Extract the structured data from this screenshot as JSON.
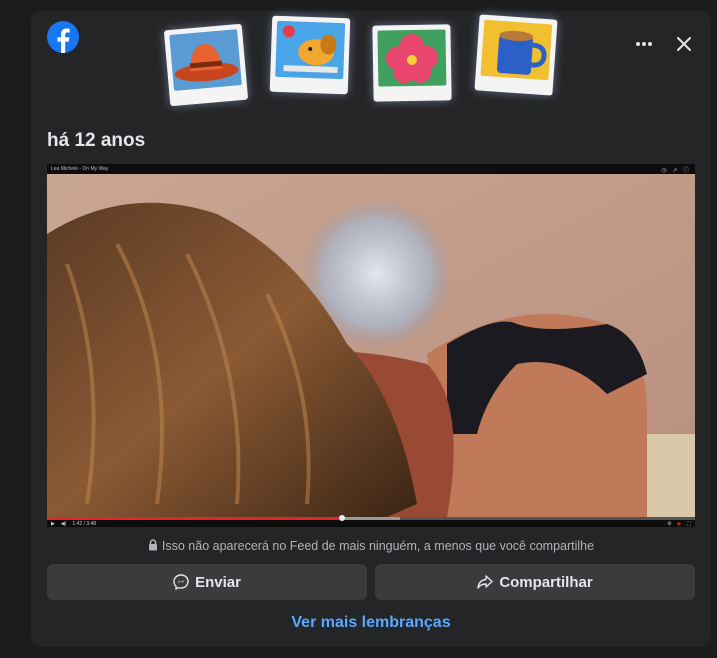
{
  "memory": {
    "date_label": "há 12 anos",
    "privacy_notice": "Isso não aparecerá no Feed de mais ninguém, a menos que você compartilhe",
    "send_label": "Enviar",
    "share_label": "Compartilhar",
    "more_memories_label": "Ver mais lembranças"
  },
  "video": {
    "title": "Lea Michele - On My Way",
    "progress": 0.455,
    "buffered": 0.545,
    "time_text": "1:42 / 3:48"
  },
  "header": {
    "polaroids": [
      "cowboy-hat-sticker",
      "dog-sticker",
      "hibiscus-flower-sticker",
      "coffee-mug-sticker"
    ]
  },
  "colors": {
    "card_bg": "#242526",
    "button_bg": "#3a3b3c",
    "link_blue": "#5aa7ff",
    "facebook_blue": "#1877f2",
    "progress_red": "#e0262a"
  }
}
